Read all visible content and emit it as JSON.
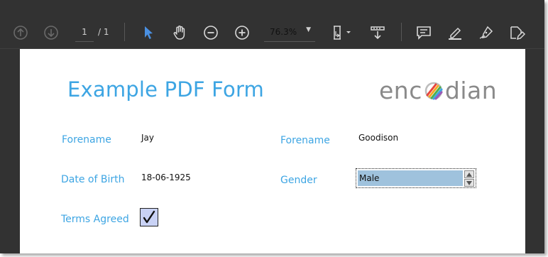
{
  "toolbar": {
    "page_current": "1",
    "page_total": "/ 1",
    "zoom": "76.3%",
    "icons": [
      "arrow-up-icon",
      "arrow-down-icon",
      "cursor-icon",
      "hand-icon",
      "zoom-out-icon",
      "zoom-in-icon",
      "fit-page-icon",
      "download-icon",
      "comment-icon",
      "highlight-icon",
      "pen-icon",
      "tag-edit-icon"
    ]
  },
  "document": {
    "title": "Example PDF Form",
    "logo": {
      "left_text": "enc",
      "right_text": "dian",
      "colors": [
        "#e8453c",
        "#f5a623",
        "#4caf50",
        "#3da5e3",
        "#9b59b6"
      ]
    },
    "fields": {
      "forename_label": "Forename",
      "forename_value": "Jay",
      "dob_label": "Date of Birth",
      "dob_value": "18-06-1925",
      "terms_label": "Terms Agreed",
      "terms_checked": "✓",
      "surname_label": "Forename",
      "surname_value": "Goodison",
      "gender_label": "Gender",
      "gender_value": "Male"
    }
  },
  "colors": {
    "accent": "#3da5e3",
    "toolbar_bg": "#323232",
    "active_tool": "#4a90e2",
    "selection": "#9fc2dd"
  }
}
